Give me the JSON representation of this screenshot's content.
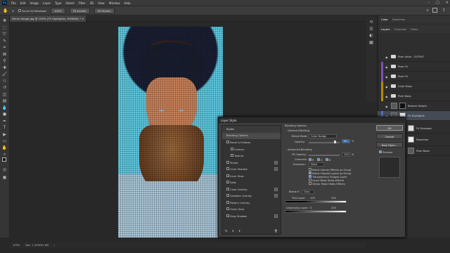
{
  "menubar": {
    "items": [
      "File",
      "Edit",
      "Image",
      "Layer",
      "Type",
      "Select",
      "Filter",
      "3D",
      "View",
      "Window",
      "Help"
    ]
  },
  "options": {
    "scroll_all": "Scroll All Windows",
    "zoom": "100%",
    "fit_screen": "Fit Screen",
    "fill_screen": "Fill Screen"
  },
  "document": {
    "tab": "Demo Image.jpg @ 100% (FX Highlights, RGB/8#) *",
    "status_zoom": "100%",
    "status_doc": "Doc: 1.24M/31.8M"
  },
  "panels": {
    "color_tabs": [
      "Color",
      "Swatches"
    ],
    "layer_tabs": [
      "Layers",
      "Channels",
      "Paths"
    ]
  },
  "layers": [
    {
      "name": "Pixel Artist - OUTPUT",
      "type": "group-header",
      "color": "#5a5a5a"
    },
    {
      "name": "Pixel FX",
      "type": "folder",
      "color": "#8a6d00"
    },
    {
      "name": "Pixel FX",
      "type": "folder",
      "color": "#8a6d00"
    },
    {
      "name": "Color Maps",
      "type": "folder",
      "color": "#8a6d00"
    },
    {
      "name": "Pixel Basis",
      "type": "folder",
      "color": "#8a6d00"
    },
    {
      "name": "Restore Details",
      "type": "layer",
      "color": "#2f2f2f"
    },
    {
      "name": "FX Highlights",
      "type": "layer",
      "color": "#5a6dc0",
      "selected": true
    },
    {
      "name": "FX Shadows",
      "type": "layer",
      "color": "#5a6dc0"
    },
    {
      "name": "Posterizer",
      "type": "layer",
      "color": "#2f2f2f"
    },
    {
      "name": "Pixel Basis",
      "type": "layer",
      "color": "#2f2f2f"
    }
  ],
  "dialog": {
    "title": "Layer Style",
    "styles_header": "Styles",
    "blending_options": "Blending Options",
    "effects": [
      {
        "label": "Bevel & Emboss",
        "plus": false
      },
      {
        "label": "Contour",
        "plus": false
      },
      {
        "label": "Texture",
        "plus": false
      },
      {
        "label": "Stroke",
        "plus": true
      },
      {
        "label": "Inner Shadow",
        "plus": true
      },
      {
        "label": "Inner Glow",
        "plus": false
      },
      {
        "label": "Satin",
        "plus": false
      },
      {
        "label": "Color Overlay",
        "plus": true
      },
      {
        "label": "Gradient Overlay",
        "plus": true
      },
      {
        "label": "Pattern Overlay",
        "plus": false
      },
      {
        "label": "Outer Glow",
        "plus": false
      },
      {
        "label": "Drop Shadow",
        "plus": true
      }
    ],
    "blending_title": "Blending Options",
    "general_blending": "General Blending",
    "blend_mode_label": "Blend Mode:",
    "blend_mode_value": "Color Dodge",
    "opacity_label": "Opacity:",
    "opacity_value": "90",
    "pct": "%",
    "advanced_blending": "Advanced Blending",
    "fill_opacity_label": "Fill Opacity:",
    "fill_opacity_value": "100",
    "channels_label": "Channels:",
    "channels": [
      "R",
      "G",
      "B"
    ],
    "knockout_label": "Knockout:",
    "knockout_value": "None",
    "checks": [
      {
        "label": "Blend Interior Effects as Group",
        "checked": false
      },
      {
        "label": "Blend Clipped Layers as Group",
        "checked": true
      },
      {
        "label": "Transparency Shapes Layer",
        "checked": true
      },
      {
        "label": "Layer Mask Hides Effects",
        "checked": false
      },
      {
        "label": "Vector Mask Hides Effects",
        "checked": false
      }
    ],
    "blend_if_label": "Blend If:",
    "blend_if_value": "Gray",
    "this_layer_label": "This Layer:",
    "this_layer_values": [
      "100",
      "255"
    ],
    "underlying_label": "Underlying Layer:",
    "underlying_values": [
      "0",
      "255"
    ],
    "ok": "OK",
    "cancel": "Cancel",
    "new_style": "New Style...",
    "preview": "Preview",
    "fx_label": "fx"
  }
}
